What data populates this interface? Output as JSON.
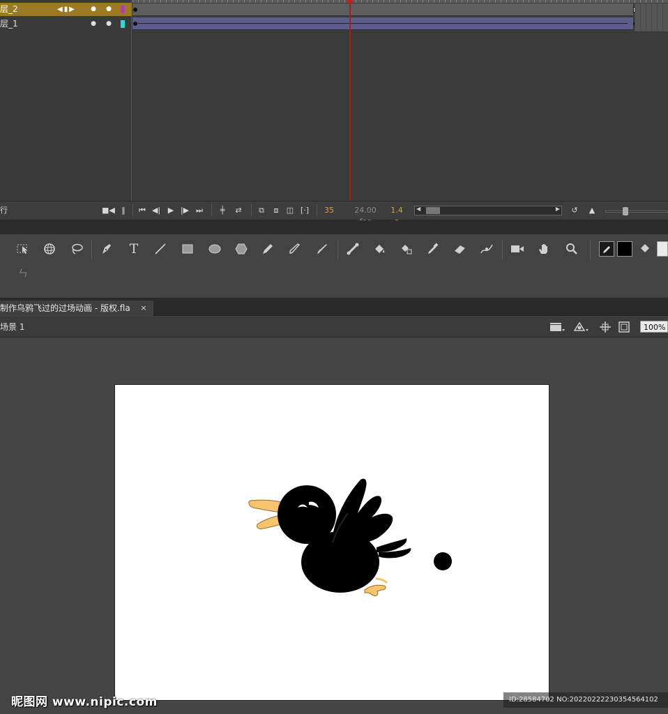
{
  "timeline": {
    "layers": [
      {
        "name": "层_2",
        "color": "#b43fb0",
        "selected": true
      },
      {
        "name": "层_1",
        "color": "#2ad8d8",
        "selected": false
      }
    ],
    "controls": {
      "left_label": "行",
      "current_frame": "35",
      "fps": "24.00 fps",
      "time": "1.4 s"
    }
  },
  "toolbar": {
    "tools": [
      "free-transform",
      "3d-rotation",
      "lasso",
      "pen",
      "text",
      "line",
      "rectangle",
      "oval",
      "polystar",
      "pencil",
      "paint-brush",
      "brush",
      "bone",
      "paint-bucket",
      "ink-bottle",
      "eyedropper",
      "eraser",
      "width",
      "camera",
      "hand",
      "zoom"
    ],
    "text_tool_glyph": "T",
    "subtool_glyph": "ㄣ",
    "stroke_color": "#1a1a1a",
    "fill_color": "#000000"
  },
  "document": {
    "tab_title": "制作乌鸦飞过的过场动画 - 版权.fla",
    "close_glyph": "×"
  },
  "scene": {
    "label": "场景 1",
    "zoom": "100%"
  },
  "stage": {
    "background": "#ffffff",
    "crow_body": "#000000",
    "crow_beak": "#f5c46c"
  },
  "watermarks": {
    "left": "昵图网 www.nipic.com",
    "right": "ID:28584702 NO:20220222230354564102"
  }
}
